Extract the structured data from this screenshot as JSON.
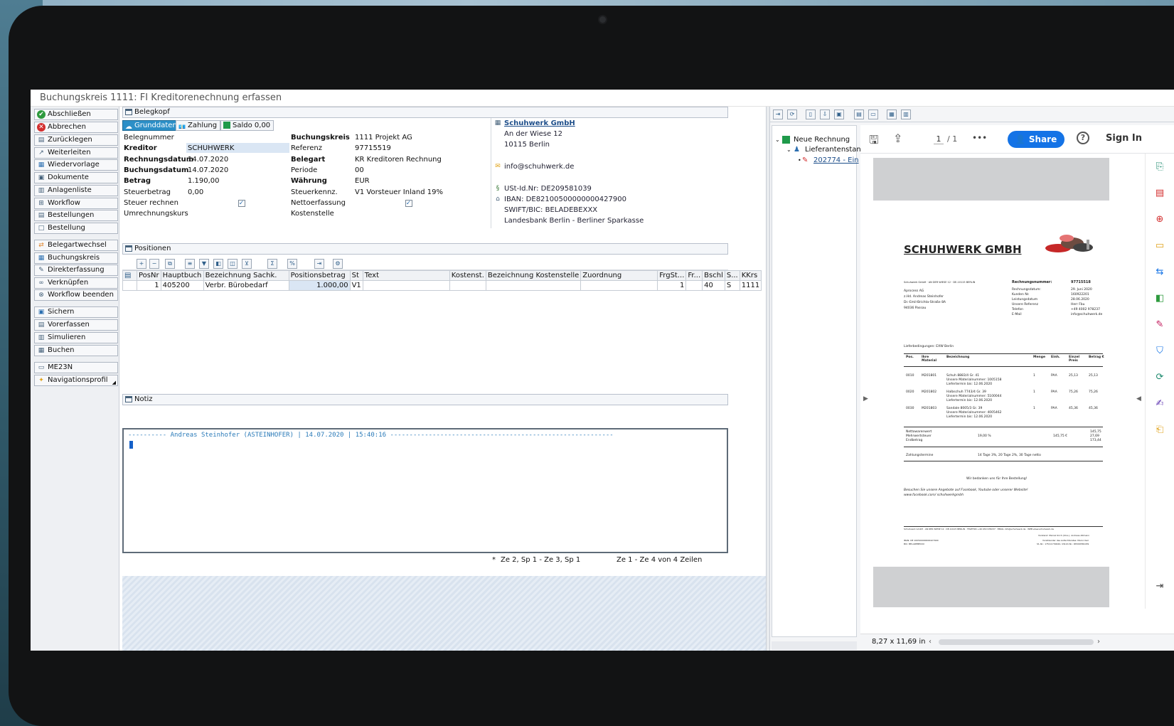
{
  "window": {
    "title": "Buchungskreis 1111: FI Kreditorenechnung erfassen"
  },
  "actions": [
    {
      "label": "Abschließen",
      "icon": "check-circle-icon"
    },
    {
      "label": "Abbrechen",
      "icon": "cancel-circle-icon"
    },
    {
      "label": "Zurücklegen",
      "icon": "stack-icon"
    },
    {
      "label": "Weiterleiten",
      "icon": "forward-icon"
    },
    {
      "label": "Wiedervorlage",
      "icon": "calendar-icon"
    },
    {
      "label": "Dokumente",
      "icon": "documents-icon"
    },
    {
      "label": "Anlagenliste",
      "icon": "attachment-list-icon"
    },
    {
      "label": "Workflow",
      "icon": "workflow-icon"
    },
    {
      "label": "Bestellungen",
      "icon": "orders-icon"
    },
    {
      "label": "Bestellung",
      "icon": "order-icon"
    },
    {
      "label": "Belegartwechsel",
      "icon": "swap-icon"
    },
    {
      "label": "Buchungskreis",
      "icon": "company-code-icon"
    },
    {
      "label": "Direkterfassung",
      "icon": "direct-entry-icon"
    },
    {
      "label": "Verknüpfen",
      "icon": "link-icon"
    },
    {
      "label": "Workflow beenden",
      "icon": "workflow-end-icon"
    },
    {
      "label": "Sichern",
      "icon": "save-icon"
    },
    {
      "label": "Vorerfassen",
      "icon": "park-icon"
    },
    {
      "label": "Simulieren",
      "icon": "simulate-icon"
    },
    {
      "label": "Buchen",
      "icon": "post-icon"
    },
    {
      "label": "ME23N",
      "icon": "transaction-icon"
    },
    {
      "label": "Navigationsprofil",
      "icon": "profile-icon"
    }
  ],
  "belegkopf": {
    "header": "Belegkopf",
    "tabs": [
      "Grunddaten",
      "Zahlung"
    ],
    "saldo": "Saldo 0,00",
    "left_fields": [
      {
        "label": "Belegnummer",
        "value": "",
        "bold": false
      },
      {
        "label": "Kreditor",
        "value": "SCHUHWERK",
        "bold": true
      },
      {
        "label": "Rechnungsdatum",
        "value": "14.07.2020",
        "bold": true
      },
      {
        "label": "Buchungsdatum",
        "value": "14.07.2020",
        "bold": true
      },
      {
        "label": "Betrag",
        "value": "1.190,00",
        "bold": true
      },
      {
        "label": "Steuerbetrag",
        "value": "0,00",
        "bold": false
      },
      {
        "label": "Steuer rechnen",
        "value": "",
        "bold": false,
        "checked": true
      },
      {
        "label": "Umrechnungskurs",
        "value": "",
        "bold": false
      }
    ],
    "right_fields": [
      {
        "label": "Buchungskreis",
        "value": "1111 Projekt AG",
        "bold": true,
        "dropdown": true
      },
      {
        "label": "Referenz",
        "value": "97715519",
        "bold": false
      },
      {
        "label": "Belegart",
        "value": "KR Kreditoren Rechnung",
        "bold": true,
        "dropdown": true
      },
      {
        "label": "Periode",
        "value": "00",
        "bold": false
      },
      {
        "label": "Währung",
        "value": "EUR",
        "bold": true
      },
      {
        "label": "Steuerkennz.",
        "value": "V1 Vorsteuer Inland 19%",
        "bold": false,
        "dropdown": true
      },
      {
        "label": "Nettoerfassung",
        "value": "",
        "bold": false,
        "checked": true
      },
      {
        "label": "Kostenstelle",
        "value": "",
        "bold": false
      }
    ]
  },
  "vendor": {
    "name": "Schuhwerk GmbH",
    "street": "An der Wiese 12",
    "city": "10115 Berlin",
    "email": "info@schuhwerk.de",
    "vat": "USt-Id.Nr: DE209581039",
    "iban": "IBAN: DE82100500000000427900",
    "bic": "SWIFT/BIC: BELADEBEXXX",
    "bank": "Landesbank Berlin - Berliner Sparkasse"
  },
  "positionen": {
    "header": "Positionen",
    "columns": [
      "PosNr",
      "Hauptbuch",
      "Bezeichnung Sachk.",
      "Positionsbetrag",
      "St",
      "Text",
      "Kostenst.",
      "Bezeichnung Kostenstelle",
      "Zuordnung",
      "FrgSt...",
      "Fr...",
      "Bschl",
      "S...",
      "KKrs"
    ],
    "rows": [
      [
        "1",
        "405200",
        "Verbr. Bürobedarf",
        "1.000,00",
        "V1",
        "",
        "",
        "",
        "",
        "1",
        "",
        "40",
        "S",
        "1111"
      ]
    ]
  },
  "notiz": {
    "header": "Notiz",
    "line": "---------- Andreas Steinhofer (ASTEINHOFER) | 14.07.2020 | 15:40:16 ----------------------------------------------------------"
  },
  "status": {
    "marker": "*",
    "cursor": "Ze 2, Sp 1 - Ze 3, Sp 1",
    "lines": "Ze 1 - Ze 4 von 4 Zeilen"
  },
  "tree": {
    "root": "Neue Rechnung",
    "child": "Lieferantenstan",
    "file": "202774 - Ein"
  },
  "pdf": {
    "page_current": "1",
    "page_total": "/ 1",
    "share": "Share",
    "signin": "Sign In",
    "page_size": "8,27 x 11,69 in",
    "doc": {
      "company": "SCHUHWERK GMBH",
      "sender": "Schuhwerk GmbH · AN DER WIESE 12 · DE-10115 BERLIN",
      "recipient": [
        "Aprocess AG",
        "z.Hd. Andreas Steinhofer",
        "Dr.-Emil-Brichta-Straße 8A",
        "94036 Passau"
      ],
      "invoice_label": "Rechnungsnummer:",
      "invoice_no": "97715518",
      "meta": [
        [
          "Rechnungsdatum:",
          "29. Juni 2020"
        ],
        [
          "Kunden Nr.",
          "160922201"
        ],
        [
          "Leistungsdatum",
          "28.06.2020"
        ],
        [
          "Unsere Referenz",
          "Herr Fbu"
        ],
        [
          "Telefon",
          "+49 4002 978237"
        ],
        [
          "E-Mail",
          "info@schuhwerk.de"
        ]
      ],
      "delivery": "Lieferbedingungen: EXW Berlin",
      "cols": [
        "Pos.",
        "Ihre Material",
        "Bezeichnung",
        "Menge",
        "Einh.",
        "Einzel Preis",
        "Betrag €"
      ],
      "items": [
        [
          "0010",
          "M201801",
          "Schuh 8883/4 Gr. 41",
          "1",
          "PAA",
          "25,13",
          "25,13"
        ],
        [
          "0020",
          "M201802",
          "Halbschuh 7743/4 Gr. 39",
          "1",
          "PAA",
          "75,26",
          "75,26"
        ],
        [
          "0030",
          "M201803",
          "Sandale 8005/3 Gr. 39",
          "1",
          "PAA",
          "45,36",
          "45,36"
        ]
      ],
      "item_notes": [
        [
          "Unsere Materialnummer: 1005158",
          "Liefertermin bis: 12.06.2020"
        ],
        [
          "Unsere Materialnummer: 5100044",
          "Liefertermin bis: 12.06.2020"
        ],
        [
          "Unsere Materialnummer: 4005462",
          "Liefertermin bis: 12.06.2020"
        ]
      ],
      "totals": [
        [
          "Nettowarenwert",
          "",
          "",
          "145,75"
        ],
        [
          "Mehrwertsteuer",
          "19,00 %",
          "145,75 €",
          "27,69"
        ],
        [
          "Endbetrag",
          "",
          "",
          "173,44"
        ]
      ],
      "payment_label": "Zahlungstermine",
      "payment": "14 Tage 3%, 20 Tage 2%, 30 Tage netto",
      "thanks": "Wir bedanken uns für Ihre Bestellung!",
      "social": "Besuchen Sie unsere Angebote auf Facebook, Youtube oder unserer Website!",
      "social_url": "www.facebook.com/ schuhwerkgmbh",
      "footer": "Schuhwerk GmbH · AN DER WIESE 12 · DE-10115 BERLIN · TELEFON +49 030 978237 · EMAIL info@schuhwerk.de · WEB www.schuhwerk.de",
      "footer_bank": "IBAN: DE 100500000000427900",
      "footer_bic": "BIC: BELADEBEXXX",
      "footer_board": "Vorstand: Marcel Kirch (Vors.), Andreas Altmann",
      "footer_board2": "Vorsitzender des Aufsichtsrates: Marco Keil",
      "footer_tax": "St.-Nr.: 175/11730020, USt-ID-Nr.: DE209581039"
    }
  },
  "colors": {
    "accent": "#2c8fc7",
    "share": "#1473e6",
    "notiz_text": "#2b7bb9"
  }
}
